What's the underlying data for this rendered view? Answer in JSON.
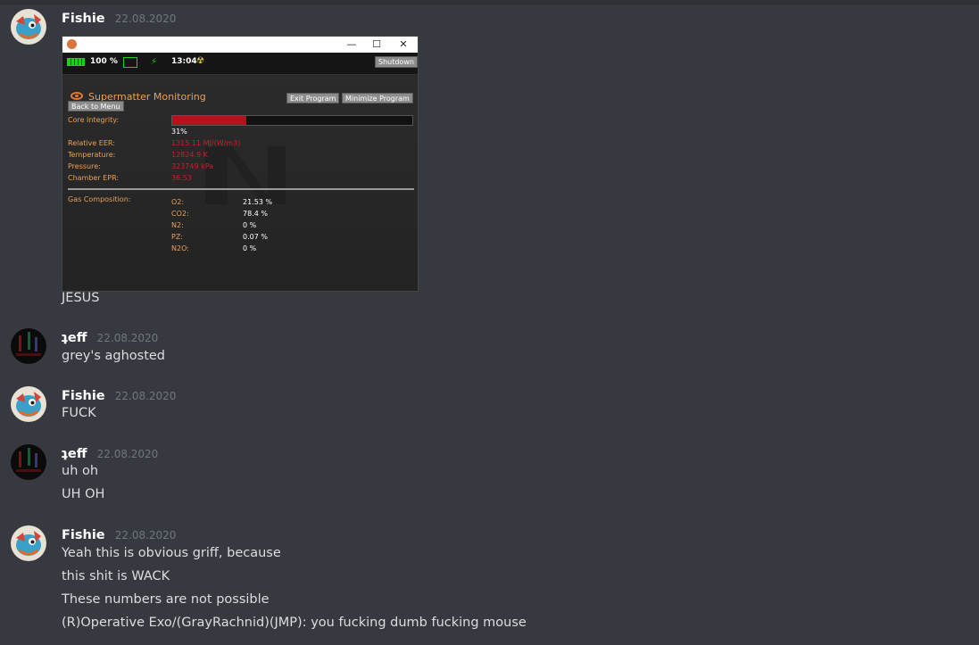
{
  "messages": [
    {
      "username": "Fishie",
      "timestamp": "22.08.2020",
      "avatar": "fish-avatar",
      "lines": [
        "JESUS"
      ],
      "attachment": {
        "status": {
          "battery_percent": "100 %",
          "time": "13:04",
          "shutdown_label": "Shutdown"
        },
        "title": "Supermatter Monitoring",
        "exit_label": "Exit Program",
        "minimize_label": "Minimize Program",
        "back_label": "Back to Menu",
        "core_integrity_label": "Core Integrity:",
        "core_integrity_value": "31%",
        "core_integrity_fraction": 0.31,
        "readings": [
          {
            "label": "Relative EER:",
            "value": "1315.11 MJ/(W/m3)"
          },
          {
            "label": "Temperature:",
            "value": "12824.9 K"
          },
          {
            "label": "Pressure:",
            "value": "323749 kPa"
          },
          {
            "label": "Chamber EPR:",
            "value": "36.53"
          }
        ],
        "gas_label": "Gas Composition:",
        "gases": [
          {
            "name": "O2:",
            "value": "21.53 %"
          },
          {
            "name": "CO2:",
            "value": "78.4 %"
          },
          {
            "name": "N2:",
            "value": "0 %"
          },
          {
            "name": "PZ:",
            "value": "0.07 %"
          },
          {
            "name": "N2O:",
            "value": "0 %"
          }
        ]
      }
    },
    {
      "username": "ʇeff",
      "timestamp": "22.08.2020",
      "avatar": "dark-avatar",
      "lines": [
        "grey's aghosted"
      ]
    },
    {
      "username": "Fishie",
      "timestamp": "22.08.2020",
      "avatar": "fish-avatar",
      "lines": [
        "FUCK"
      ]
    },
    {
      "username": "ʇeff",
      "timestamp": "22.08.2020",
      "avatar": "dark-avatar",
      "lines": [
        "uh oh",
        "UH OH"
      ]
    },
    {
      "username": "Fishie",
      "timestamp": "22.08.2020",
      "avatar": "fish-avatar",
      "lines": [
        "Yeah this is obvious griff, because",
        "this shit is WACK",
        "These numbers are not possible",
        "(R)Operative Exo/(GrayRachnid)(JMP): you fucking dumb fucking mouse"
      ]
    }
  ],
  "colors": {
    "background": "#36393f",
    "username": "#ffffff",
    "timestamp": "#72767d",
    "text": "#dcddde",
    "app_label": "#e8a15c",
    "app_red": "#c8202a",
    "bar_fill": "#b3131b"
  }
}
